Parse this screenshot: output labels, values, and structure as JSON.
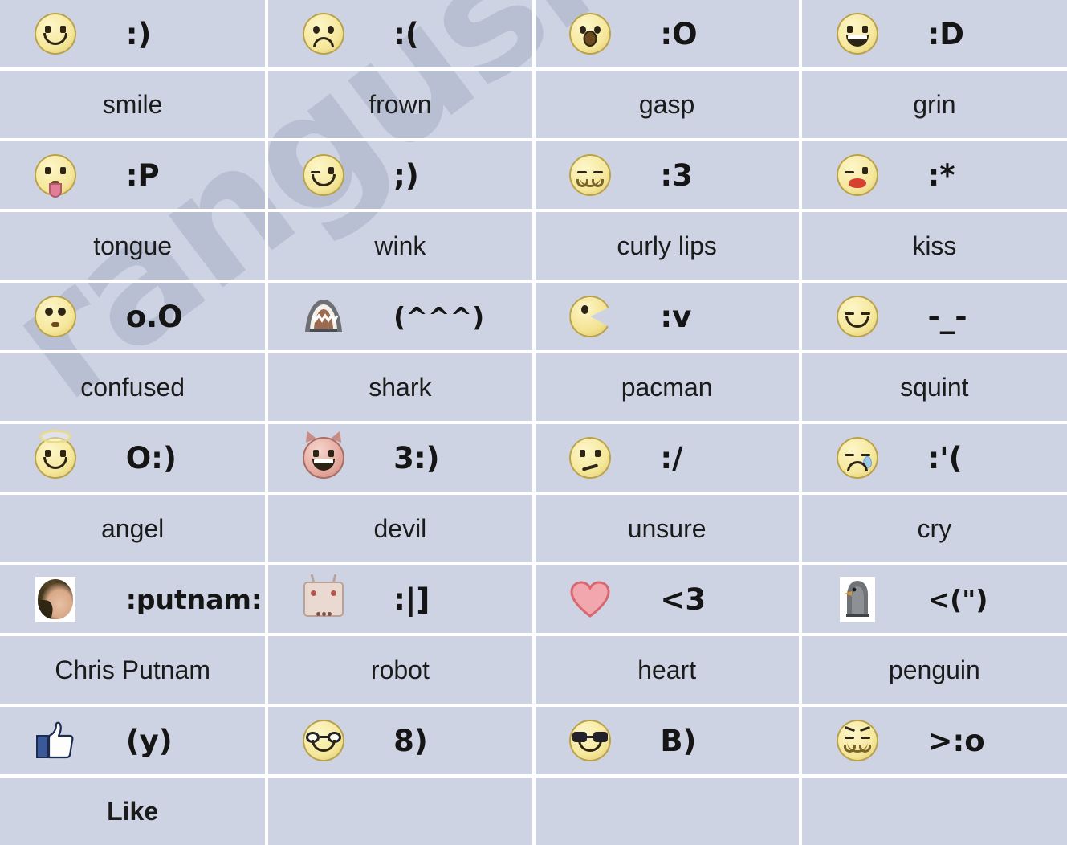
{
  "watermark": {
    "text": "ranguski.in"
  },
  "theme": {
    "background": "#ced3e3",
    "gridline": "#ffffff",
    "text": "#1b1b1b",
    "code_text": "#151515",
    "watermark_color": "#9aa4bf"
  },
  "table": {
    "columns": 4,
    "rows": [
      {
        "cells": [
          {
            "icon": "smile-face-icon",
            "code": ":)",
            "label": "smile"
          },
          {
            "icon": "frown-face-icon",
            "code": ":(",
            "label": "frown"
          },
          {
            "icon": "gasp-face-icon",
            "code": ":O",
            "label": "gasp"
          },
          {
            "icon": "grin-face-icon",
            "code": ":D",
            "label": "grin"
          }
        ]
      },
      {
        "cells": [
          {
            "icon": "tongue-face-icon",
            "code": ":P",
            "label": "tongue"
          },
          {
            "icon": "wink-face-icon",
            "code": ";)",
            "label": "wink"
          },
          {
            "icon": "curly-lips-face-icon",
            "code": ":3",
            "label": "curly lips"
          },
          {
            "icon": "kiss-face-icon",
            "code": ":*",
            "label": "kiss"
          }
        ]
      },
      {
        "cells": [
          {
            "icon": "confused-face-icon",
            "code": "o.O",
            "label": "confused"
          },
          {
            "icon": "shark-icon",
            "code": "(^^^)",
            "label": "shark"
          },
          {
            "icon": "pacman-icon",
            "code": ":v",
            "label": "pacman"
          },
          {
            "icon": "squint-face-icon",
            "code": "-_-",
            "label": "squint"
          }
        ]
      },
      {
        "cells": [
          {
            "icon": "angel-face-icon",
            "code": "O:)",
            "label": "angel"
          },
          {
            "icon": "devil-face-icon",
            "code": "3:)",
            "label": "devil"
          },
          {
            "icon": "unsure-face-icon",
            "code": ":/",
            "label": "unsure"
          },
          {
            "icon": "cry-face-icon",
            "code": ":'(",
            "label": "cry"
          }
        ]
      },
      {
        "cells": [
          {
            "icon": "chris-putnam-avatar-icon",
            "code": ":putnam:",
            "label": "Chris Putnam",
            "code_bold": true
          },
          {
            "icon": "robot-icon",
            "code": ":|]",
            "label": "robot"
          },
          {
            "icon": "heart-icon",
            "code": "<3",
            "label": "heart"
          },
          {
            "icon": "penguin-icon",
            "code": "<(\")",
            "label": "penguin"
          }
        ]
      },
      {
        "cells": [
          {
            "icon": "thumbs-up-like-icon",
            "code": "(y)",
            "label": "Like",
            "label_bold": true
          },
          {
            "icon": "glasses-face-icon",
            "code": "8)",
            "label": ""
          },
          {
            "icon": "sunglasses-face-icon",
            "code": "B)",
            "label": ""
          },
          {
            "icon": "angry-gasp-face-icon",
            "code": ">:o",
            "label": ""
          }
        ]
      }
    ]
  }
}
